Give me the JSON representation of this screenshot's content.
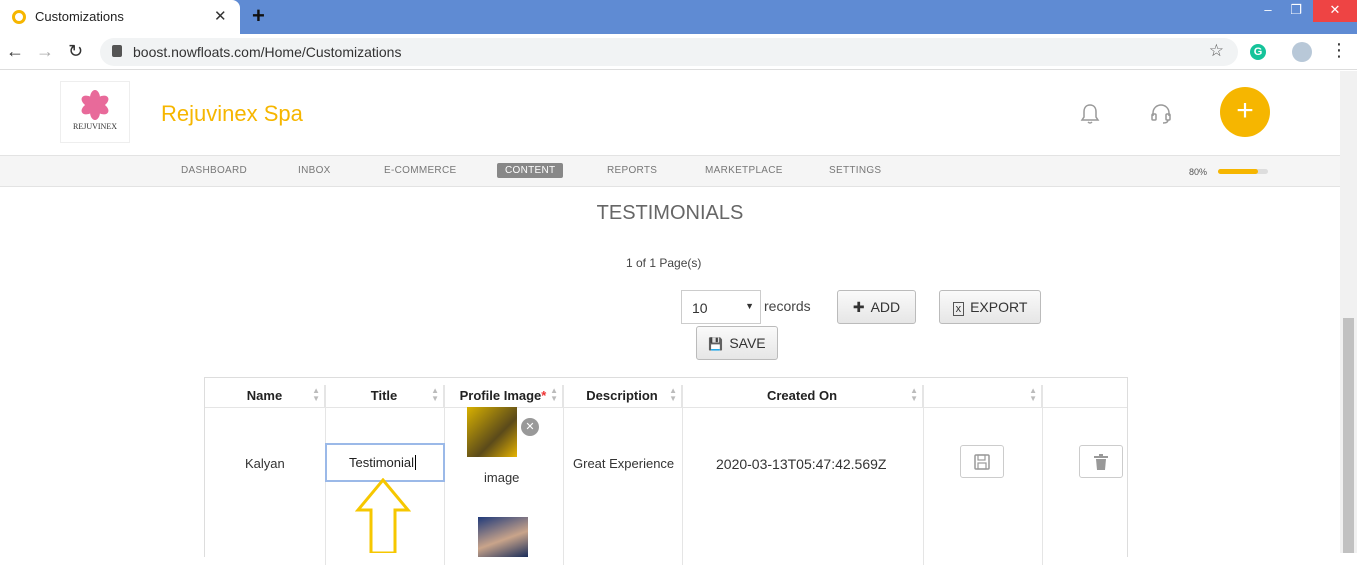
{
  "browser": {
    "tab_title": "Customizations",
    "url": "boost.nowfloats.com/Home/Customizations"
  },
  "header": {
    "logo_text": "REJUVINEX",
    "brand": "Rejuvinex Spa",
    "fab_label": "+"
  },
  "nav": {
    "items": [
      "DASHBOARD",
      "INBOX",
      "E-COMMERCE",
      "CONTENT",
      "REPORTS",
      "MARKETPLACE",
      "SETTINGS"
    ],
    "active": "CONTENT",
    "progress_label": "80%",
    "progress_value": 0.8
  },
  "main": {
    "title": "TESTIMONIALS",
    "pager": "1 of 1 Page(s)",
    "page_size": "10",
    "records_label": "records",
    "add_label": "ADD",
    "export_label": "EXPORT",
    "save_label": "SAVE"
  },
  "table": {
    "headers": [
      "Name",
      "Title",
      "Profile Image",
      "Description",
      "Created On",
      "",
      ""
    ],
    "required_mark": "*",
    "row": {
      "name": "Kalyan",
      "title": "Testimonial",
      "image_label": "image",
      "description": "Great Experience",
      "created_on": "2020-03-13T05:47:42.569Z"
    }
  },
  "colors": {
    "accent": "#f6b600",
    "tab_bar": "#5f8bd3",
    "arrow": "#f6c700"
  }
}
